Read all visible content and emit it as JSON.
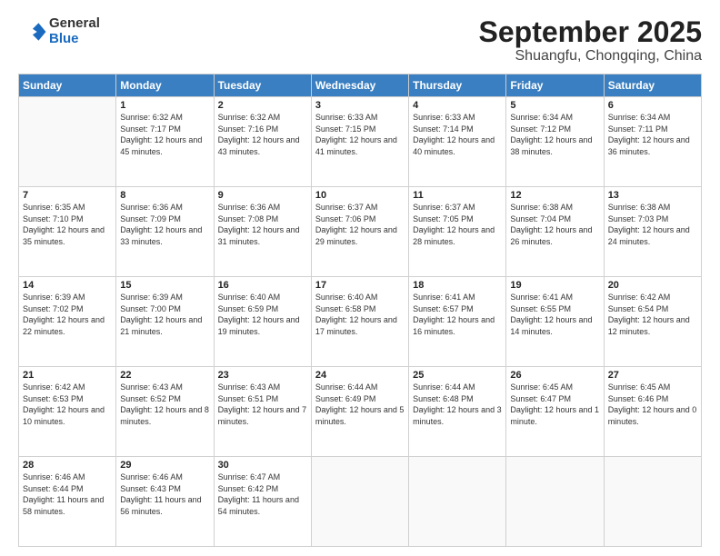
{
  "header": {
    "logo": {
      "general": "General",
      "blue": "Blue"
    },
    "title": "September 2025",
    "subtitle": "Shuangfu, Chongqing, China"
  },
  "days_of_week": [
    "Sunday",
    "Monday",
    "Tuesday",
    "Wednesday",
    "Thursday",
    "Friday",
    "Saturday"
  ],
  "weeks": [
    [
      {
        "day": "",
        "info": ""
      },
      {
        "day": "1",
        "info": "Sunrise: 6:32 AM\nSunset: 7:17 PM\nDaylight: 12 hours\nand 45 minutes."
      },
      {
        "day": "2",
        "info": "Sunrise: 6:32 AM\nSunset: 7:16 PM\nDaylight: 12 hours\nand 43 minutes."
      },
      {
        "day": "3",
        "info": "Sunrise: 6:33 AM\nSunset: 7:15 PM\nDaylight: 12 hours\nand 41 minutes."
      },
      {
        "day": "4",
        "info": "Sunrise: 6:33 AM\nSunset: 7:14 PM\nDaylight: 12 hours\nand 40 minutes."
      },
      {
        "day": "5",
        "info": "Sunrise: 6:34 AM\nSunset: 7:12 PM\nDaylight: 12 hours\nand 38 minutes."
      },
      {
        "day": "6",
        "info": "Sunrise: 6:34 AM\nSunset: 7:11 PM\nDaylight: 12 hours\nand 36 minutes."
      }
    ],
    [
      {
        "day": "7",
        "info": "Sunrise: 6:35 AM\nSunset: 7:10 PM\nDaylight: 12 hours\nand 35 minutes."
      },
      {
        "day": "8",
        "info": "Sunrise: 6:36 AM\nSunset: 7:09 PM\nDaylight: 12 hours\nand 33 minutes."
      },
      {
        "day": "9",
        "info": "Sunrise: 6:36 AM\nSunset: 7:08 PM\nDaylight: 12 hours\nand 31 minutes."
      },
      {
        "day": "10",
        "info": "Sunrise: 6:37 AM\nSunset: 7:06 PM\nDaylight: 12 hours\nand 29 minutes."
      },
      {
        "day": "11",
        "info": "Sunrise: 6:37 AM\nSunset: 7:05 PM\nDaylight: 12 hours\nand 28 minutes."
      },
      {
        "day": "12",
        "info": "Sunrise: 6:38 AM\nSunset: 7:04 PM\nDaylight: 12 hours\nand 26 minutes."
      },
      {
        "day": "13",
        "info": "Sunrise: 6:38 AM\nSunset: 7:03 PM\nDaylight: 12 hours\nand 24 minutes."
      }
    ],
    [
      {
        "day": "14",
        "info": "Sunrise: 6:39 AM\nSunset: 7:02 PM\nDaylight: 12 hours\nand 22 minutes."
      },
      {
        "day": "15",
        "info": "Sunrise: 6:39 AM\nSunset: 7:00 PM\nDaylight: 12 hours\nand 21 minutes."
      },
      {
        "day": "16",
        "info": "Sunrise: 6:40 AM\nSunset: 6:59 PM\nDaylight: 12 hours\nand 19 minutes."
      },
      {
        "day": "17",
        "info": "Sunrise: 6:40 AM\nSunset: 6:58 PM\nDaylight: 12 hours\nand 17 minutes."
      },
      {
        "day": "18",
        "info": "Sunrise: 6:41 AM\nSunset: 6:57 PM\nDaylight: 12 hours\nand 16 minutes."
      },
      {
        "day": "19",
        "info": "Sunrise: 6:41 AM\nSunset: 6:55 PM\nDaylight: 12 hours\nand 14 minutes."
      },
      {
        "day": "20",
        "info": "Sunrise: 6:42 AM\nSunset: 6:54 PM\nDaylight: 12 hours\nand 12 minutes."
      }
    ],
    [
      {
        "day": "21",
        "info": "Sunrise: 6:42 AM\nSunset: 6:53 PM\nDaylight: 12 hours\nand 10 minutes."
      },
      {
        "day": "22",
        "info": "Sunrise: 6:43 AM\nSunset: 6:52 PM\nDaylight: 12 hours\nand 8 minutes."
      },
      {
        "day": "23",
        "info": "Sunrise: 6:43 AM\nSunset: 6:51 PM\nDaylight: 12 hours\nand 7 minutes."
      },
      {
        "day": "24",
        "info": "Sunrise: 6:44 AM\nSunset: 6:49 PM\nDaylight: 12 hours\nand 5 minutes."
      },
      {
        "day": "25",
        "info": "Sunrise: 6:44 AM\nSunset: 6:48 PM\nDaylight: 12 hours\nand 3 minutes."
      },
      {
        "day": "26",
        "info": "Sunrise: 6:45 AM\nSunset: 6:47 PM\nDaylight: 12 hours\nand 1 minute."
      },
      {
        "day": "27",
        "info": "Sunrise: 6:45 AM\nSunset: 6:46 PM\nDaylight: 12 hours\nand 0 minutes."
      }
    ],
    [
      {
        "day": "28",
        "info": "Sunrise: 6:46 AM\nSunset: 6:44 PM\nDaylight: 11 hours\nand 58 minutes."
      },
      {
        "day": "29",
        "info": "Sunrise: 6:46 AM\nSunset: 6:43 PM\nDaylight: 11 hours\nand 56 minutes."
      },
      {
        "day": "30",
        "info": "Sunrise: 6:47 AM\nSunset: 6:42 PM\nDaylight: 11 hours\nand 54 minutes."
      },
      {
        "day": "",
        "info": ""
      },
      {
        "day": "",
        "info": ""
      },
      {
        "day": "",
        "info": ""
      },
      {
        "day": "",
        "info": ""
      }
    ]
  ]
}
